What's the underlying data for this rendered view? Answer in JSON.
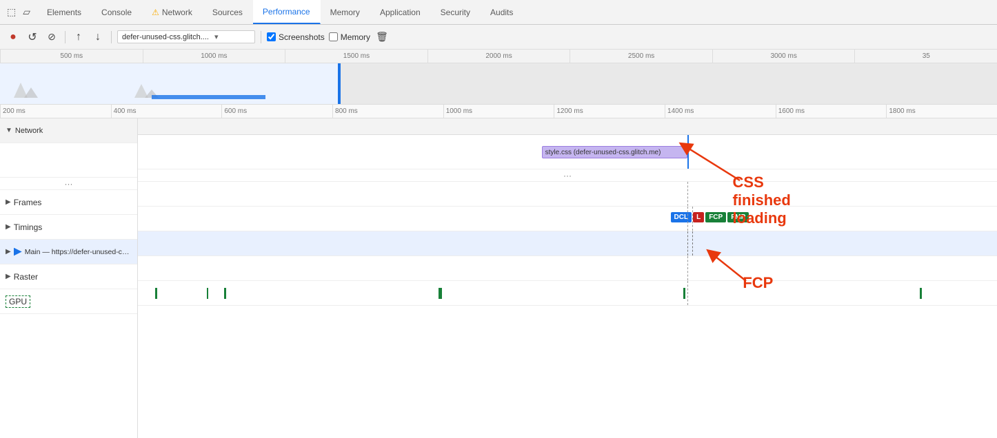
{
  "tabs": {
    "items": [
      {
        "label": "Elements",
        "id": "elements",
        "active": false
      },
      {
        "label": "Console",
        "id": "console",
        "active": false
      },
      {
        "label": "Network",
        "id": "network",
        "active": false,
        "hasWarning": true
      },
      {
        "label": "Sources",
        "id": "sources",
        "active": false
      },
      {
        "label": "Performance",
        "id": "performance",
        "active": true
      },
      {
        "label": "Memory",
        "id": "memory",
        "active": false
      },
      {
        "label": "Application",
        "id": "application",
        "active": false
      },
      {
        "label": "Security",
        "id": "security",
        "active": false
      },
      {
        "label": "Audits",
        "id": "audits",
        "active": false
      }
    ]
  },
  "toolbar": {
    "record_label": "●",
    "reload_label": "↺",
    "clear_label": "⊘",
    "upload_label": "↑",
    "download_label": "↓",
    "url": "defer-unused-css.glitch....",
    "screenshots_label": "Screenshots",
    "memory_label": "Memory",
    "delete_label": "🗑"
  },
  "ruler_top": {
    "marks": [
      "500 ms",
      "1000 ms",
      "1500 ms",
      "2000 ms",
      "2500 ms",
      "3000 ms",
      "35"
    ]
  },
  "ruler_bottom": {
    "marks": [
      "200 ms",
      "400 ms",
      "600 ms",
      "800 ms",
      "1000 ms",
      "1200 ms",
      "1400 ms",
      "1600 ms",
      "1800 ms"
    ]
  },
  "network_section": {
    "label": "Network",
    "resource_label": "style.css (defer-unused-css.glitch.me)"
  },
  "tracks": [
    {
      "label": "Frames",
      "expandable": true
    },
    {
      "label": "Timings",
      "expandable": true
    },
    {
      "label": "Main — https://defer-unused-css.glitch.me/index-unoptimized.html",
      "expandable": true,
      "selected": true
    },
    {
      "label": "Raster",
      "expandable": true
    },
    {
      "label": "GPU",
      "expandable": false,
      "dashed": true
    }
  ],
  "badges": {
    "dcl": "DCL",
    "l": "L",
    "fcp": "FCP",
    "fmp": "FMP"
  },
  "annotations": {
    "css_label": "CSS finished loading",
    "fcp_label": "FCP"
  }
}
